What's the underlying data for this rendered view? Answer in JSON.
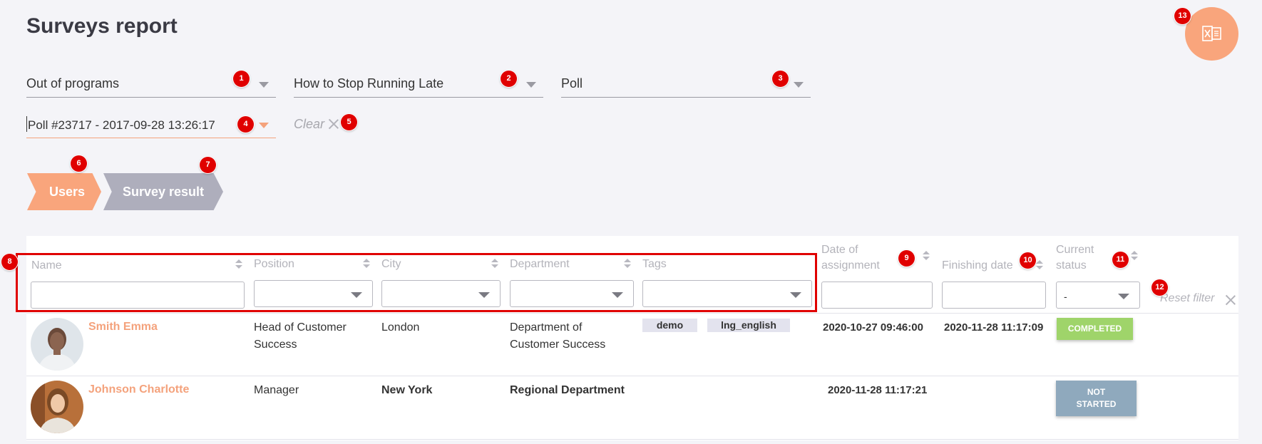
{
  "page": {
    "title": "Surveys report"
  },
  "filters": {
    "program": "Out of programs",
    "course": "How to Stop Running Late",
    "type": "Poll",
    "poll": "Poll #23717 - 2017-09-28 13:26:17",
    "clear_label": "Clear"
  },
  "tabs": {
    "users": "Users",
    "survey_result": "Survey result"
  },
  "table": {
    "headers": {
      "name": "Name",
      "position": "Position",
      "city": "City",
      "department": "Department",
      "tags": "Tags",
      "date_of_assignment_1": "Date of",
      "date_of_assignment_2": "assignment",
      "finishing_date": "Finishing date",
      "current_status_1": "Current",
      "current_status_2": "status"
    },
    "status_filter_value": "-",
    "reset_filter_label": "Reset filter",
    "rows": [
      {
        "name": "Smith Emma",
        "position_1": "Head of Customer",
        "position_2": "Success",
        "city": "London",
        "department_1": "Department of",
        "department_2": "Customer Success",
        "tags": [
          "demo",
          "lng_english"
        ],
        "date_assigned": "2020-10-27 09:46:00",
        "finishing_date": "2020-11-28 11:17:09",
        "status": "COMPLETED"
      },
      {
        "name": "Johnson Charlotte",
        "position_1": "Manager",
        "position_2": "",
        "city": "New York",
        "department_1": "Regional Department",
        "department_2": "",
        "tags": [],
        "date_assigned": "2020-11-28 11:17:21",
        "finishing_date": "",
        "status_1": "NOT",
        "status_2": "STARTED"
      }
    ]
  },
  "annotations": [
    "1",
    "2",
    "3",
    "4",
    "5",
    "6",
    "7",
    "8",
    "9",
    "10",
    "11",
    "12",
    "13"
  ],
  "colors": {
    "accent": "#f9a57c",
    "completed": "#9fd46a",
    "not_started": "#8fa9bd",
    "annotation": "#e00000"
  }
}
